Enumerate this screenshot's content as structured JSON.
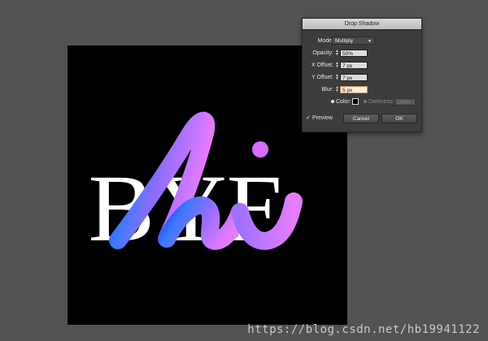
{
  "artwork": {
    "serif_text": "BYE",
    "script_text": "hi",
    "colors": {
      "serif": "#ffffff",
      "gradient_start": "#2e3bff",
      "gradient_mid": "#8b6cff",
      "gradient_end": "#e07bff",
      "background": "#000000"
    }
  },
  "dialog": {
    "title": "Drop Shadow",
    "mode": {
      "label": "Mode:",
      "value": "Multiply"
    },
    "opacity": {
      "label": "Opacity:",
      "value": "50%"
    },
    "x_offset": {
      "label": "X Offset:",
      "value": "7 px"
    },
    "y_offset": {
      "label": "Y Offset:",
      "value": "7 px"
    },
    "blur": {
      "label": "Blur:",
      "value": "5 px"
    },
    "color": {
      "label": "Color:"
    },
    "darkness": {
      "label": "Darkness:",
      "value": "100%"
    },
    "preview": {
      "label": "Preview",
      "checked": true
    },
    "cancel_label": "Cancel",
    "ok_label": "OK"
  },
  "watermark": "https://blog.csdn.net/hb19941122"
}
